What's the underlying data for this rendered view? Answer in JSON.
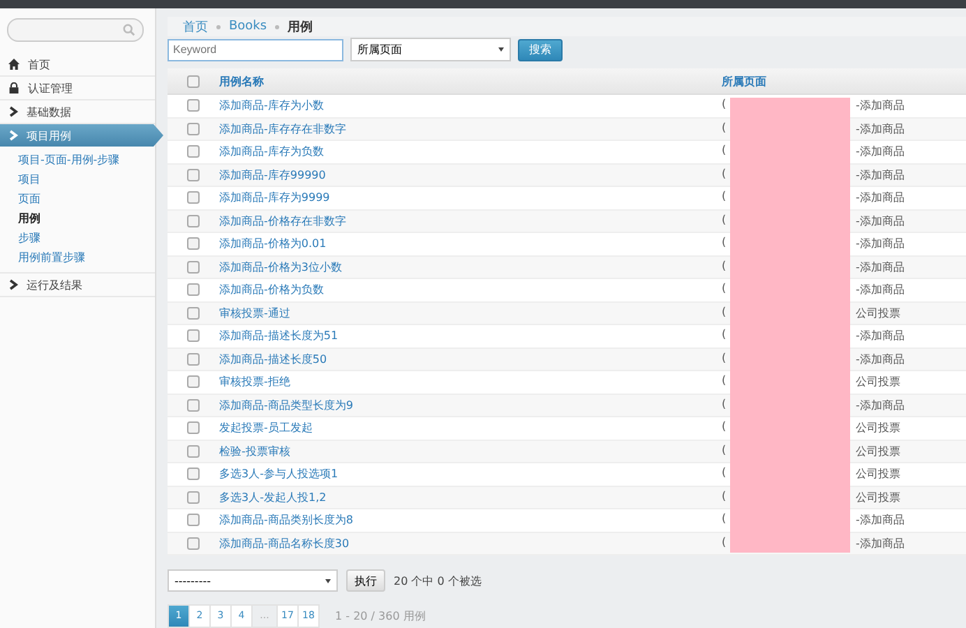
{
  "sidebar": {
    "items": [
      {
        "kind": "home",
        "label": "首页",
        "selected": false
      },
      {
        "kind": "lock",
        "label": "认证管理",
        "selected": false
      },
      {
        "kind": "section",
        "label": "基础数据",
        "selected": false
      },
      {
        "kind": "section",
        "label": "项目用例",
        "selected": true,
        "children": [
          {
            "label": "项目-页面-用例-步骤",
            "selected": false
          },
          {
            "label": "项目",
            "selected": false
          },
          {
            "label": "页面",
            "selected": false
          },
          {
            "label": "用例",
            "selected": true
          },
          {
            "label": "步骤",
            "selected": false
          },
          {
            "label": "用例前置步骤",
            "selected": false
          }
        ]
      },
      {
        "kind": "section",
        "label": "运行及结果",
        "selected": false
      }
    ]
  },
  "breadcrumb": [
    "首页",
    "Books",
    "用例"
  ],
  "filter": {
    "keyword": {
      "placeholder": "Keyword"
    },
    "page_select": "所属页面",
    "search_button": "搜索"
  },
  "table": {
    "select_all_checked": false,
    "columns": [
      "用例名称",
      "所属页面"
    ],
    "rows": [
      {
        "name": "添加商品-库存为小数",
        "page_start": "(",
        "page_end": "-添加商品",
        "checked": false
      },
      {
        "name": "添加商品-库存存在非数字",
        "page_start": "(",
        "page_end": "-添加商品",
        "checked": false
      },
      {
        "name": "添加商品-库存为负数",
        "page_start": "(",
        "page_end": "-添加商品",
        "checked": false
      },
      {
        "name": "添加商品-库存99990",
        "page_start": "(",
        "page_end": "-添加商品",
        "checked": false
      },
      {
        "name": "添加商品-库存为9999",
        "page_start": "(",
        "page_end": "-添加商品",
        "checked": false
      },
      {
        "name": "添加商品-价格存在非数字",
        "page_start": "(",
        "page_end": "-添加商品",
        "checked": false
      },
      {
        "name": "添加商品-价格为0.01",
        "page_start": "(",
        "page_end": "-添加商品",
        "checked": false
      },
      {
        "name": "添加商品-价格为3位小数",
        "page_start": "(",
        "page_end": "-添加商品",
        "checked": false
      },
      {
        "name": "添加商品-价格为负数",
        "page_start": "(",
        "page_end": "-添加商品",
        "checked": false
      },
      {
        "name": "审核投票-通过",
        "page_start": "(",
        "page_end": "公司投票",
        "checked": false
      },
      {
        "name": "添加商品-描述长度为51",
        "page_start": "(",
        "page_end": "-添加商品",
        "checked": false
      },
      {
        "name": "添加商品-描述长度50",
        "page_start": "(",
        "page_end": "-添加商品",
        "checked": false
      },
      {
        "name": "审核投票-拒绝",
        "page_start": "(",
        "page_end": "公司投票",
        "checked": false
      },
      {
        "name": "添加商品-商品类型长度为9",
        "page_start": "(",
        "page_end": "-添加商品",
        "checked": false
      },
      {
        "name": "发起投票-员工发起",
        "page_start": "(",
        "page_end": "公司投票",
        "checked": false
      },
      {
        "name": "检验-投票审核",
        "page_start": "(",
        "page_end": "公司投票",
        "checked": false
      },
      {
        "name": "多选3人-参与人投选项1",
        "page_start": "(",
        "page_end": "公司投票",
        "checked": false
      },
      {
        "name": "多选3人-发起人投1,2",
        "page_start": "(",
        "page_end": "公司投票",
        "checked": false
      },
      {
        "name": "添加商品-商品类别长度为8",
        "page_start": "(",
        "page_end": "-添加商品",
        "checked": false
      },
      {
        "name": "添加商品-商品名称长度30",
        "page_start": "(",
        "page_end": "-添加商品",
        "checked": false
      }
    ]
  },
  "actions": {
    "select": "---------",
    "run_button": "执行",
    "selection_count": "20 个中 0 个被选"
  },
  "pagination": {
    "pages": [
      {
        "label": "1",
        "selected": true
      },
      {
        "label": "2",
        "selected": false
      },
      {
        "label": "3",
        "selected": false
      },
      {
        "label": "4",
        "selected": false
      },
      {
        "label": "...",
        "kind": "gap"
      },
      {
        "label": "17",
        "selected": false
      },
      {
        "label": "18",
        "selected": false
      }
    ],
    "summary": "1 - 20 / 360 用例"
  }
}
